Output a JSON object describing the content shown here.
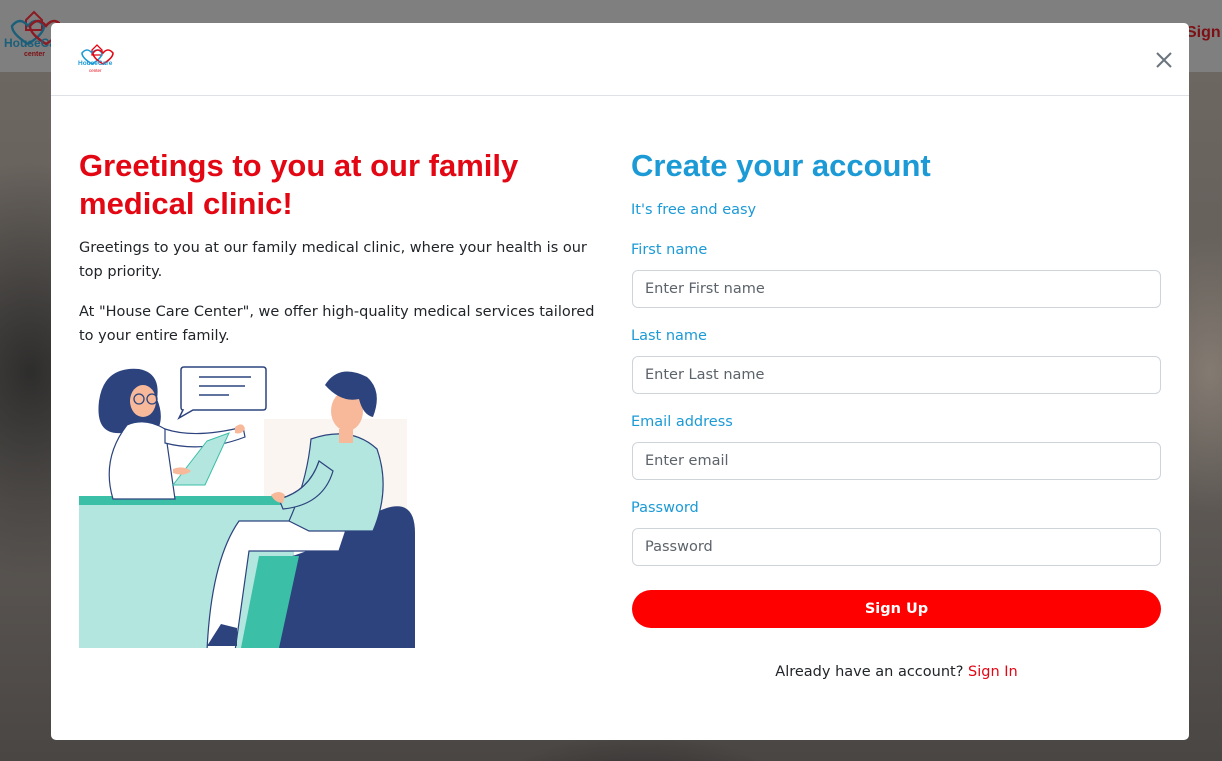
{
  "background": {
    "brand_name": "HouseCare",
    "brand_sub": "center",
    "header_signup": "Sign Up"
  },
  "modal": {
    "logo": {
      "name": "HouseCare",
      "sub": "center"
    },
    "close_icon": "close-icon"
  },
  "intro": {
    "title": "Greetings to you at our family medical clinic!",
    "paragraph1": "Greetings to you at our family medical clinic, where your health is our top priority.",
    "paragraph2": "At \"House Care Center\", we offer high-quality medical services tailored to your entire family."
  },
  "form": {
    "title": "Create your account",
    "subtitle": "It's free and easy",
    "first_name": {
      "label": "First name",
      "placeholder": "Enter First name",
      "value": ""
    },
    "last_name": {
      "label": "Last name",
      "placeholder": "Enter Last name",
      "value": ""
    },
    "email": {
      "label": "Email address",
      "placeholder": "Enter email",
      "value": ""
    },
    "password": {
      "label": "Password",
      "placeholder": "Password",
      "value": ""
    },
    "submit_label": "Sign Up",
    "signin_prompt": "Already have an account?",
    "signin_link": "Sign In"
  },
  "colors": {
    "brand_red": "#e30613",
    "button_red": "#ff0000",
    "brand_blue": "#1b9ad6",
    "illustration_navy": "#2c437e",
    "illustration_mint": "#b3e6df",
    "illustration_teal": "#3bbfa7"
  }
}
